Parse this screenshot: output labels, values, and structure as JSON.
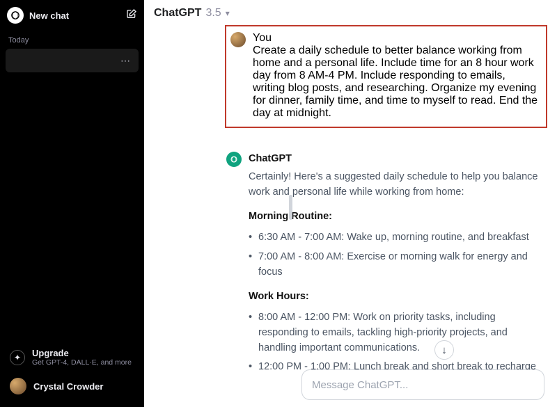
{
  "sidebar": {
    "new_chat": "New chat",
    "today_label": "Today",
    "history_item_menu": "⋯",
    "upgrade": {
      "title": "Upgrade",
      "subtitle": "Get GPT-4, DALL·E, and more"
    },
    "user": {
      "name": "Crystal Crowder"
    }
  },
  "header": {
    "model_name": "ChatGPT",
    "model_version": "3.5"
  },
  "conversation": {
    "user": {
      "sender": "You",
      "text": "Create a daily schedule to better balance working from home and a personal life. Include time for an 8 hour work day from 8 AM-4 PM. Include responding to emails, writing blog posts, and researching. Organize my evening for dinner, family time, and time to myself to read. End the day at midnight."
    },
    "assistant": {
      "sender": "ChatGPT",
      "intro": "Certainly! Here's a suggested daily schedule to help you balance work and personal life while working from home:",
      "sections": [
        {
          "title": "Morning Routine:",
          "items": [
            "6:30 AM - 7:00 AM: Wake up, morning routine, and breakfast",
            "7:00 AM - 8:00 AM: Exercise or morning walk for energy and focus"
          ]
        },
        {
          "title": "Work Hours:",
          "items": [
            "8:00 AM - 12:00 PM: Work on priority tasks, including responding to emails, tackling high-priority projects, and handling important communications.",
            "12:00 PM - 1:00 PM: Lunch break and short break to recharge"
          ]
        }
      ]
    }
  },
  "composer": {
    "placeholder": "Message ChatGPT..."
  }
}
